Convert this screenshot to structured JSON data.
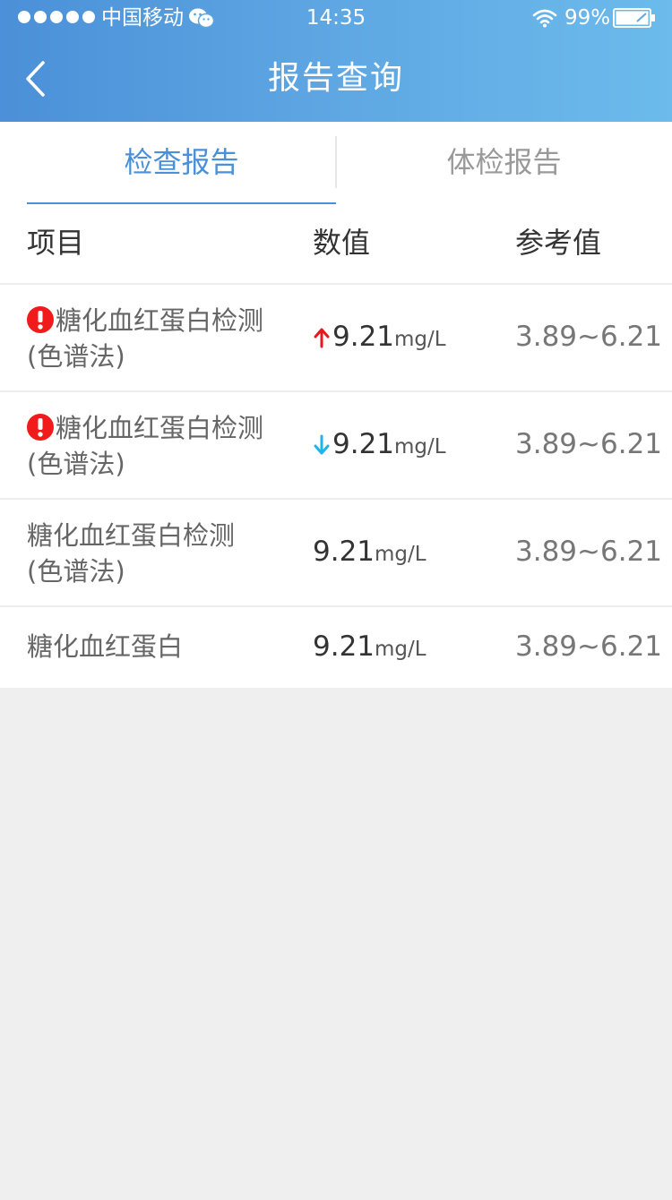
{
  "status_bar": {
    "carrier": "中国移动",
    "time": "14:35",
    "battery": "99%"
  },
  "nav": {
    "title": "报告查询",
    "back_icon": "chevron-left-icon"
  },
  "tabs": [
    {
      "label": "检查报告",
      "active": true
    },
    {
      "label": "体检报告",
      "active": false
    }
  ],
  "table": {
    "headers": {
      "item": "项目",
      "value": "数值",
      "reference": "参考值"
    },
    "rows": [
      {
        "name_line1": "糖化血红蛋白检测",
        "name_line2": "(色谱法)",
        "alert": true,
        "trend": "up",
        "value": "9.21",
        "unit": "mg/L",
        "reference": "3.89~6.21"
      },
      {
        "name_line1": "糖化血红蛋白检测",
        "name_line2": "(色谱法)",
        "alert": true,
        "trend": "down",
        "value": "9.21",
        "unit": "mg/L",
        "reference": "3.89~6.21"
      },
      {
        "name_line1": "糖化血红蛋白检测",
        "name_line2": "(色谱法)",
        "alert": false,
        "trend": "none",
        "value": "9.21",
        "unit": "mg/L",
        "reference": "3.89~6.21"
      },
      {
        "name_line1": "糖化血红蛋白",
        "name_line2": "",
        "alert": false,
        "trend": "none",
        "value": "9.21",
        "unit": "mg/L",
        "reference": "3.89~6.21"
      }
    ]
  },
  "colors": {
    "header_start": "#4b90d8",
    "header_end": "#6cbbec",
    "accent": "#4a90d9",
    "alert_red": "#f21b1b",
    "trend_up": "#e8171b",
    "trend_down": "#1cb6e8",
    "background": "#efefef"
  }
}
